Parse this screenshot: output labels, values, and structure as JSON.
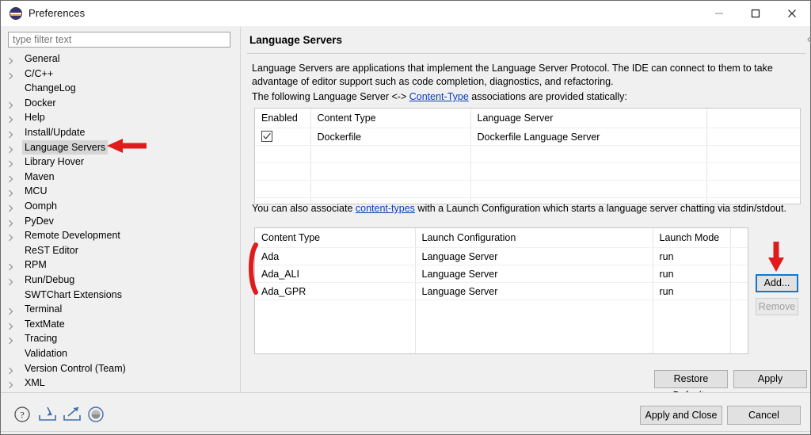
{
  "window": {
    "title": "Preferences",
    "icon": "eclipse-icon",
    "controls": {
      "minimize": "minimize-icon",
      "maximize": "maximize-icon",
      "close": "close-icon"
    }
  },
  "sidebar": {
    "filter": {
      "placeholder": "type filter text",
      "value": ""
    },
    "items": [
      {
        "label": "General",
        "expandable": true,
        "selected": false
      },
      {
        "label": "C/C++",
        "expandable": true,
        "selected": false
      },
      {
        "label": "ChangeLog",
        "expandable": false,
        "selected": false
      },
      {
        "label": "Docker",
        "expandable": true,
        "selected": false
      },
      {
        "label": "Help",
        "expandable": true,
        "selected": false
      },
      {
        "label": "Install/Update",
        "expandable": true,
        "selected": false
      },
      {
        "label": "Language Servers",
        "expandable": true,
        "selected": true
      },
      {
        "label": "Library Hover",
        "expandable": true,
        "selected": false
      },
      {
        "label": "Maven",
        "expandable": true,
        "selected": false
      },
      {
        "label": "MCU",
        "expandable": true,
        "selected": false
      },
      {
        "label": "Oomph",
        "expandable": true,
        "selected": false
      },
      {
        "label": "PyDev",
        "expandable": true,
        "selected": false
      },
      {
        "label": "Remote Development",
        "expandable": true,
        "selected": false
      },
      {
        "label": "ReST Editor",
        "expandable": false,
        "selected": false
      },
      {
        "label": "RPM",
        "expandable": true,
        "selected": false
      },
      {
        "label": "Run/Debug",
        "expandable": true,
        "selected": false
      },
      {
        "label": "SWTChart Extensions",
        "expandable": false,
        "selected": false
      },
      {
        "label": "Terminal",
        "expandable": true,
        "selected": false
      },
      {
        "label": "TextMate",
        "expandable": true,
        "selected": false
      },
      {
        "label": "Tracing",
        "expandable": true,
        "selected": false
      },
      {
        "label": "Validation",
        "expandable": false,
        "selected": false
      },
      {
        "label": "Version Control (Team)",
        "expandable": true,
        "selected": false
      },
      {
        "label": "XML",
        "expandable": true,
        "selected": false
      }
    ]
  },
  "panel": {
    "title": "Language Servers",
    "nav": {
      "back": "back-arrow-icon",
      "back_menu": "chevron-down-icon",
      "forward": "forward-arrow-icon",
      "forward_menu": "chevron-down-icon",
      "overflow": "view-menu-icon"
    },
    "description_part1": "Language Servers are applications that implement the Language Server Protocol. The IDE can connect to them to take advantage of editor support such as code completion, diagnostics, and refactoring.",
    "static_intro_pre": "The following Language Server <-> ",
    "static_intro_link": "Content-Type",
    "static_intro_post": " associations are provided statically:",
    "launch_intro_pre": "You can also associate ",
    "launch_intro_link": "content-types",
    "launch_intro_post": " with a Launch Configuration which starts a language server chatting via stdin/stdout."
  },
  "static_table": {
    "columns": [
      "Enabled",
      "Content Type",
      "Language Server",
      ""
    ],
    "rows": [
      {
        "enabled": true,
        "content_type": "Dockerfile",
        "language_server": "Dockerfile Language Server",
        "extra": ""
      }
    ],
    "empty_rows": 4
  },
  "launch_table": {
    "columns": [
      "Content Type",
      "Launch Configuration",
      "Launch Mode",
      ""
    ],
    "rows": [
      {
        "content_type": "Ada",
        "launch_configuration": "Language Server",
        "launch_mode": "run",
        "extra": ""
      },
      {
        "content_type": "Ada_ALI",
        "launch_configuration": "Language Server",
        "launch_mode": "run",
        "extra": ""
      },
      {
        "content_type": "Ada_GPR",
        "launch_configuration": "Language Server",
        "launch_mode": "run",
        "extra": ""
      }
    ]
  },
  "buttons": {
    "add": "Add...",
    "remove": "Remove",
    "restore_defaults": "Restore Defaults",
    "apply": "Apply",
    "apply_and_close": "Apply and Close",
    "cancel": "Cancel"
  },
  "bottom_icons": [
    {
      "name": "help-icon"
    },
    {
      "name": "import-icon"
    },
    {
      "name": "export-icon"
    },
    {
      "name": "oomph-recorder-icon"
    }
  ],
  "annotations": {
    "arrow_color": "#e01b1b",
    "markers": [
      {
        "name": "sidebar-arrow-annotation",
        "points_to": "Language Servers"
      },
      {
        "name": "content-type-bracket-annotation",
        "points_to": "launch table content types"
      },
      {
        "name": "add-button-arrow-annotation",
        "points_to": "Add..."
      }
    ]
  },
  "colors": {
    "link": "#0d3bbb",
    "selection": "#d6d6d6",
    "focus": "#0a7bd5",
    "window_bg": "#f0f0f0"
  }
}
